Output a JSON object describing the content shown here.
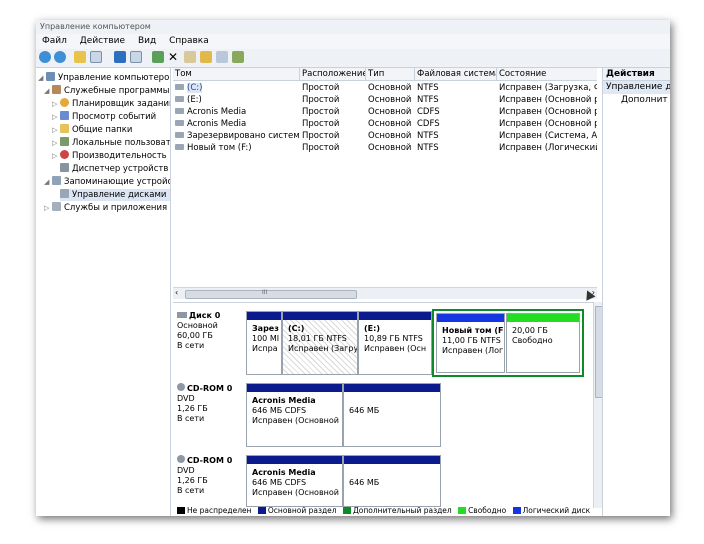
{
  "window": {
    "title": "Управление компьютером"
  },
  "menu": {
    "items": [
      "Файл",
      "Действие",
      "Вид",
      "Справка"
    ]
  },
  "toolbar": {
    "icons": [
      "back-icon",
      "forward-icon",
      "up-icon",
      "properties-icon",
      "help-icon",
      "console-icon",
      "refresh-icon",
      "delete-icon",
      "new-icon",
      "open-icon",
      "search-icon",
      "export-icon"
    ]
  },
  "tree": {
    "items": [
      {
        "label": "Управление компьютером (л",
        "level": 0,
        "icon": "computer-icon"
      },
      {
        "label": "Служебные программы",
        "level": 1,
        "icon": "tools-icon"
      },
      {
        "label": "Планировщик заданий",
        "level": 2,
        "icon": "clock-icon"
      },
      {
        "label": "Просмотр событий",
        "level": 2,
        "icon": "events-icon"
      },
      {
        "label": "Общие папки",
        "level": 2,
        "icon": "folder-icon"
      },
      {
        "label": "Локальные пользовате",
        "level": 2,
        "icon": "users-icon"
      },
      {
        "label": "Производительность",
        "level": 2,
        "icon": "performance-icon"
      },
      {
        "label": "Диспетчер устройств",
        "level": 2,
        "icon": "devices-icon"
      },
      {
        "label": "Запоминающие устройст",
        "level": 1,
        "icon": "storage-icon"
      },
      {
        "label": "Управление дисками",
        "level": 2,
        "icon": "disk-icon"
      },
      {
        "label": "Службы и приложения",
        "level": 1,
        "icon": "services-icon"
      }
    ]
  },
  "volumes": {
    "columns": [
      "Том",
      "Расположение",
      "Тип",
      "Файловая система",
      "Состояние"
    ],
    "rows": [
      [
        "(C:)",
        "Простой",
        "Основной",
        "NTFS",
        "Исправен (Загрузка, Фай"
      ],
      [
        "(E:)",
        "Простой",
        "Основной",
        "NTFS",
        "Исправен (Основной раз"
      ],
      [
        "Acronis Media",
        "Простой",
        "Основной",
        "CDFS",
        "Исправен (Основной раз"
      ],
      [
        "Acronis Media",
        "Простой",
        "Основной",
        "CDFS",
        "Исправен (Основной раз"
      ],
      [
        "Зарезервировано системой",
        "Простой",
        "Основной",
        "NTFS",
        "Исправен (Система, Акти"
      ],
      [
        "Новый том (F:)",
        "Простой",
        "Основной",
        "NTFS",
        "Исправен (Логический д"
      ]
    ]
  },
  "scroll": {
    "left_arrow": "‹",
    "grip": "III",
    "right_arrow": "›"
  },
  "disks": [
    {
      "name": "Диск 0",
      "type": "Основной",
      "size": "60,00 ГБ",
      "status": "В сети",
      "parts": [
        {
          "l1": "Зарез",
          "l2": "100 МІ",
          "l3": "Испра",
          "bar": "#0b1a8c"
        },
        {
          "l1": "(C:)",
          "l2": "18,01 ГБ NTFS",
          "l3": "Исправен (Загру",
          "bar": "#0b1a8c"
        },
        {
          "l1": "(E:)",
          "l2": "10,89 ГБ NTFS",
          "l3": "Исправен (Осн",
          "bar": "#0b1a8c"
        },
        {
          "l1": "Новый том  (F",
          "l2": "11,00 ГБ NTFS",
          "l3": "Исправен (Лог",
          "bar": "#1535e0"
        },
        {
          "l1": "",
          "l2": "20,00 ГБ",
          "l3": "Свободно",
          "bar": "#22dd22"
        }
      ]
    },
    {
      "name": "CD-ROM 0",
      "type": "DVD",
      "size": "1,26 ГБ",
      "status": "В сети",
      "parts": [
        {
          "l1": "Acronis Media",
          "l2": "646 МБ CDFS",
          "l3": "Исправен (Основной",
          "bar": "#0b1a8c"
        },
        {
          "l1": "",
          "l2": "646 МБ",
          "l3": "",
          "bar": "#0b1a8c"
        }
      ]
    },
    {
      "name": "CD-ROM 0",
      "type": "DVD",
      "size": "1,26 ГБ",
      "status": "В сети",
      "parts": [
        {
          "l1": "Acronis Media",
          "l2": "646 МБ CDFS",
          "l3": "Исправен (Основной",
          "bar": "#0b1a8c"
        },
        {
          "l1": "",
          "l2": "646 МБ",
          "l3": "",
          "bar": "#0b1a8c"
        }
      ]
    }
  ],
  "legend": {
    "items": [
      {
        "label": "Не распределен",
        "color": "#000000"
      },
      {
        "label": "Основной раздел",
        "color": "#0b1a8c"
      },
      {
        "label": "Дополнительный раздел",
        "color": "#0d8a2a"
      },
      {
        "label": "Свободно",
        "color": "#22dd22"
      },
      {
        "label": "Логический диск",
        "color": "#1535e0"
      }
    ]
  },
  "actions": {
    "header": "Действия",
    "items": [
      "Управление ди",
      "Дополнит"
    ]
  }
}
